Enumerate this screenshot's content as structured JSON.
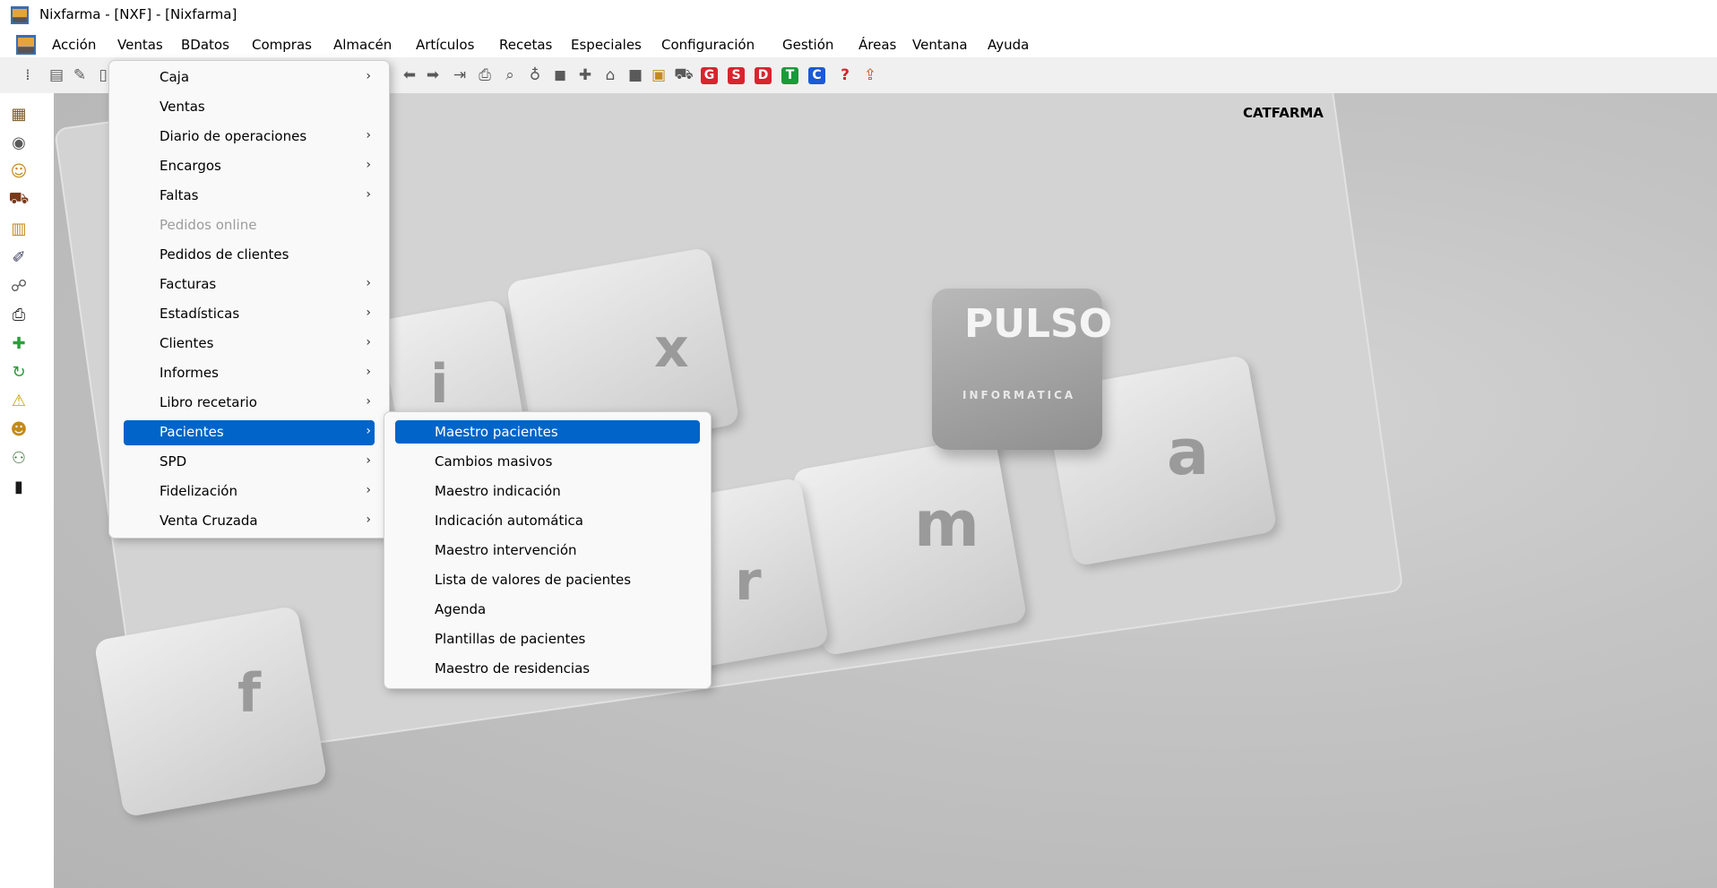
{
  "window": {
    "title": "Nixfarma - [NXF] - [Nixfarma]"
  },
  "menubar": [
    "Acción",
    "Ventas",
    "BDatos",
    "Compras",
    "Almacén",
    "Artículos",
    "Recetas",
    "Especiales",
    "Configuración",
    "Gestión",
    "Áreas",
    "Ventana",
    "Ayuda"
  ],
  "toolbar": {
    "letter_buttons": [
      {
        "label": "G",
        "color": "#d9242f"
      },
      {
        "label": "S",
        "color": "#d9242f"
      },
      {
        "label": "D",
        "color": "#d9242f"
      },
      {
        "label": "T",
        "color": "#1a9a3a"
      },
      {
        "label": "C",
        "color": "#1a5ad8"
      }
    ],
    "help_glyph": "?"
  },
  "company": "CATFARMA",
  "logo": {
    "brand": "PULSO",
    "tagline": "INFORMATICA"
  },
  "background_letters": [
    "i",
    "x",
    "f",
    "r",
    "m",
    "a"
  ],
  "ventas_menu": [
    {
      "label": "Caja",
      "submenu": true
    },
    {
      "label": "Ventas",
      "submenu": false
    },
    {
      "label": "Diario de operaciones",
      "submenu": true
    },
    {
      "label": "Encargos",
      "submenu": true
    },
    {
      "label": "Faltas",
      "submenu": true
    },
    {
      "label": "Pedidos online",
      "submenu": false,
      "disabled": true
    },
    {
      "label": "Pedidos de clientes",
      "submenu": false
    },
    {
      "label": "Facturas",
      "submenu": true
    },
    {
      "label": "Estadísticas",
      "submenu": true
    },
    {
      "label": "Clientes",
      "submenu": true
    },
    {
      "label": "Informes",
      "submenu": true
    },
    {
      "label": "Libro recetario",
      "submenu": true
    },
    {
      "label": "Pacientes",
      "submenu": true,
      "highlighted": true
    },
    {
      "label": "SPD",
      "submenu": true
    },
    {
      "label": "Fidelización",
      "submenu": true
    },
    {
      "label": "Venta Cruzada",
      "submenu": true
    }
  ],
  "pacientes_menu": [
    {
      "label": "Maestro pacientes",
      "highlighted": true
    },
    {
      "label": "Cambios masivos"
    },
    {
      "label": "Maestro indicación"
    },
    {
      "label": "Indicación automática"
    },
    {
      "label": "Maestro intervención"
    },
    {
      "label": "Lista de valores de pacientes"
    },
    {
      "label": "Agenda"
    },
    {
      "label": "Plantillas de pacientes"
    },
    {
      "label": "Maestro de residencias"
    }
  ],
  "arrow_glyph": "›"
}
